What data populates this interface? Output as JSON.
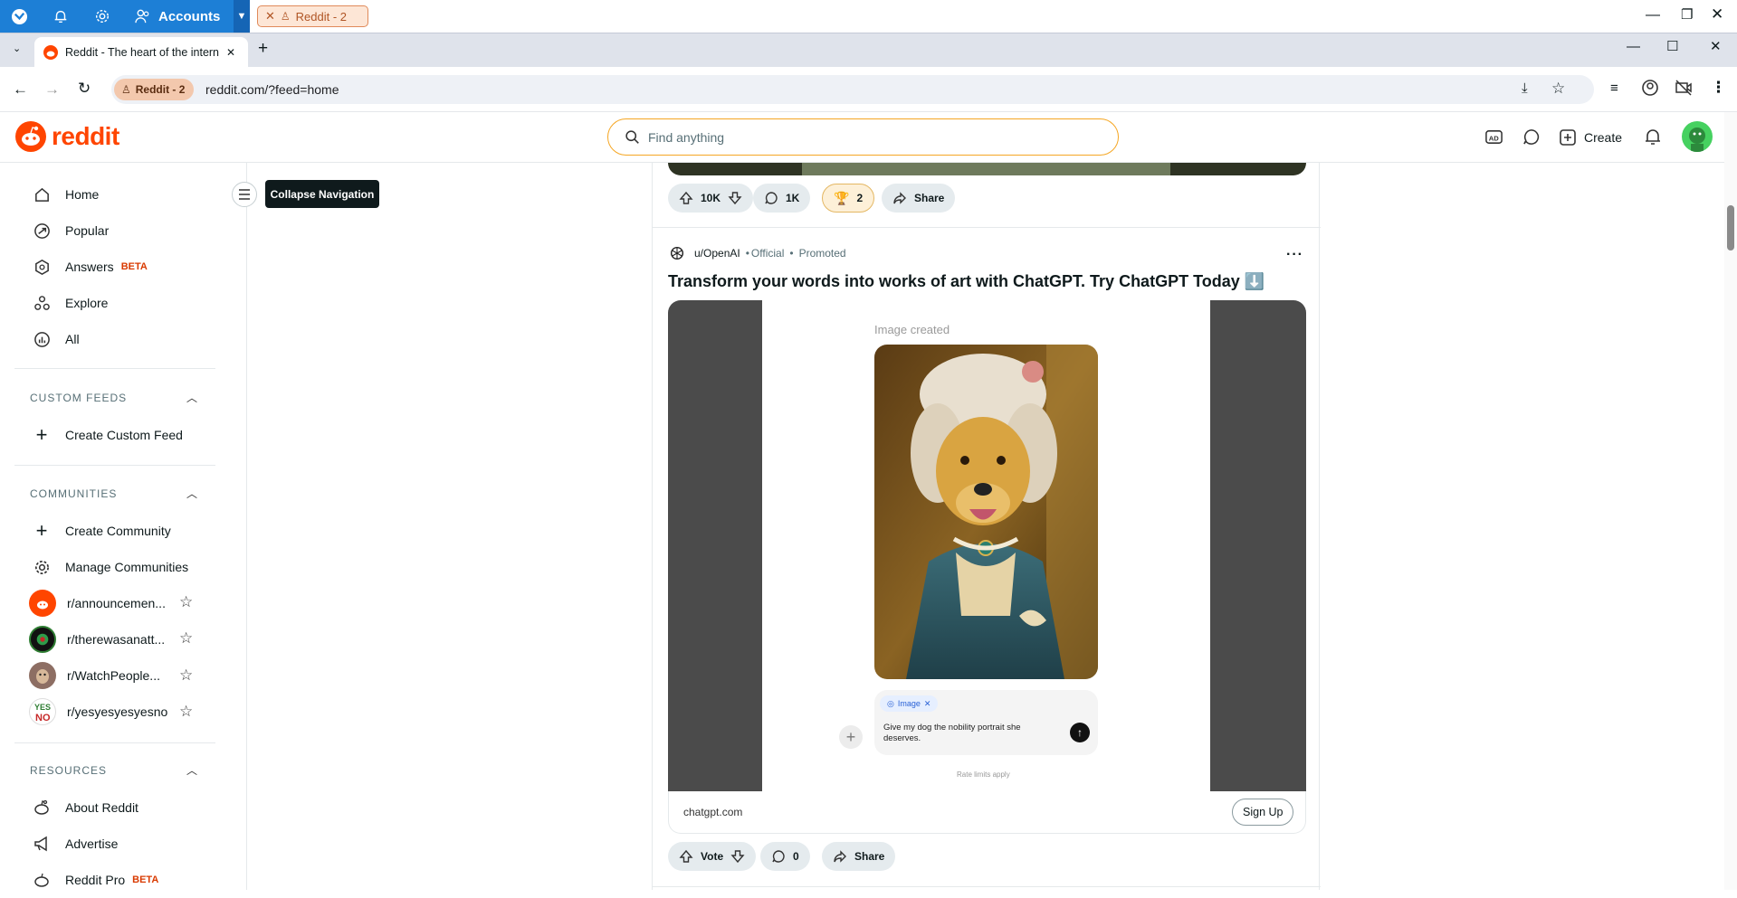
{
  "os": {
    "accounts_label": "Accounts",
    "pill_label": "Reddit - 2"
  },
  "browser": {
    "tab_title": "Reddit - The heart of the internet",
    "new_tab": "+",
    "profile_chip": "Reddit - 2",
    "url": "reddit.com/?feed=home"
  },
  "header": {
    "logo_text": "reddit",
    "search_placeholder": "Find anything",
    "create_label": "Create"
  },
  "sidebar": {
    "nav": [
      {
        "label": "Home"
      },
      {
        "label": "Popular"
      },
      {
        "label": "Answers",
        "badge": "BETA"
      },
      {
        "label": "Explore"
      },
      {
        "label": "All"
      }
    ],
    "custom_feeds_title": "CUSTOM FEEDS",
    "create_custom_feed": "Create Custom Feed",
    "communities_title": "COMMUNITIES",
    "create_community": "Create Community",
    "manage_communities": "Manage Communities",
    "communities": [
      {
        "name": "r/announcemen..."
      },
      {
        "name": "r/therewasanatt..."
      },
      {
        "name": "r/WatchPeople..."
      },
      {
        "name": "r/yesyesyesyesno"
      }
    ],
    "resources_title": "RESOURCES",
    "resources": [
      {
        "label": "About Reddit"
      },
      {
        "label": "Advertise"
      },
      {
        "label": "Reddit Pro",
        "badge": "BETA"
      }
    ],
    "tooltip": "Collapse Navigation"
  },
  "prev_post": {
    "votes": "10K",
    "comments": "1K",
    "awards": "2",
    "share": "Share"
  },
  "post": {
    "author": "u/OpenAI",
    "official": "Official",
    "promoted": "Promoted",
    "title": "Transform your words into works of art with ChatGPT. Try ChatGPT Today ⬇️",
    "image_caption": "Image created",
    "image_chip": "Image",
    "prompt_text": "Give my dog the nobility portrait she deserves.",
    "rate_limits": "Rate limits apply",
    "domain": "chatgpt.com",
    "cta": "Sign Up",
    "vote": "Vote",
    "comments": "0",
    "share": "Share"
  }
}
